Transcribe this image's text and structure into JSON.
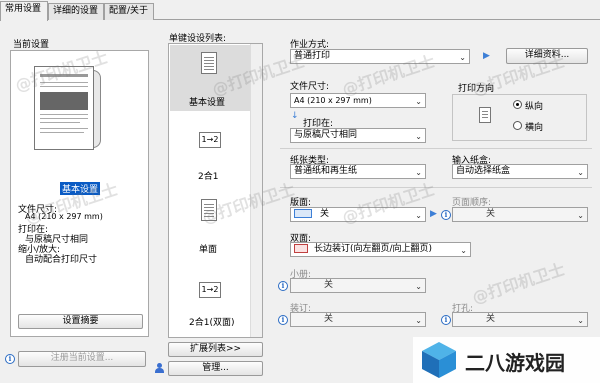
{
  "tabs": [
    "常用设置",
    "详细的设置",
    "配置/关于"
  ],
  "current_settings": {
    "title": "当前设置",
    "selected_label": "基本设置",
    "paper_size_label": "文件尺寸:",
    "paper_size_value": "A4 (210 x 297 mm)",
    "print_on_label": "打印在:",
    "print_on_value": "与原稿尺寸相同",
    "scale_label": "缩小/放大:",
    "scale_value": "自动配合打印尺寸",
    "summary_button": "设置摘要"
  },
  "presets": {
    "title": "单键设设列表:",
    "items": [
      "基本设置",
      "2合1",
      "单面",
      "2合1(双面)"
    ],
    "icon_text_2in1": "1→2",
    "icon_text_2in1_duplex": "1→2",
    "expand_button": "扩展列表>>",
    "manage_button": "管理..."
  },
  "register_button": "注册当前设置...",
  "job": {
    "label": "作业方式:",
    "value": "普通打印",
    "details_button": "详细资料..."
  },
  "paper_size": {
    "label": "文件尺寸:",
    "value": "A4 (210 x 297 mm)"
  },
  "print_on": {
    "label": "打印在:",
    "value": "与原稿尺寸相同"
  },
  "orientation": {
    "label": "打印方向",
    "options": [
      "纵向",
      "横向"
    ],
    "selected": "纵向"
  },
  "paper_type": {
    "label": "纸张类型:",
    "value": "普通纸和再生纸"
  },
  "paper_source": {
    "label": "输入纸盒:",
    "value": "自动选择纸盒"
  },
  "layout": {
    "label": "版面:",
    "value": "关"
  },
  "page_order": {
    "label": "页面顺序:",
    "value": "关"
  },
  "duplex": {
    "label": "双面:",
    "value": "长边装订(向左翻页/向上翻页)"
  },
  "booklet": {
    "label": "小册:",
    "value": "关"
  },
  "binding": {
    "label": "装订:",
    "value": "关"
  },
  "punch": {
    "label": "打孔:",
    "value": "关"
  },
  "watermarks": [
    "@打印机卫士",
    "@打印机卫士",
    "@打印机卫士",
    "@打印机卫士",
    "@打印机卫士",
    "@打印机卫士",
    "@打印机卫士",
    "@打印机卫士"
  ],
  "brand": {
    "name": "二八游戏园"
  },
  "colors": {
    "selection": "#0a5bc4",
    "info": "#2b6cc4",
    "arrow_blue": "#3d7fd6"
  }
}
